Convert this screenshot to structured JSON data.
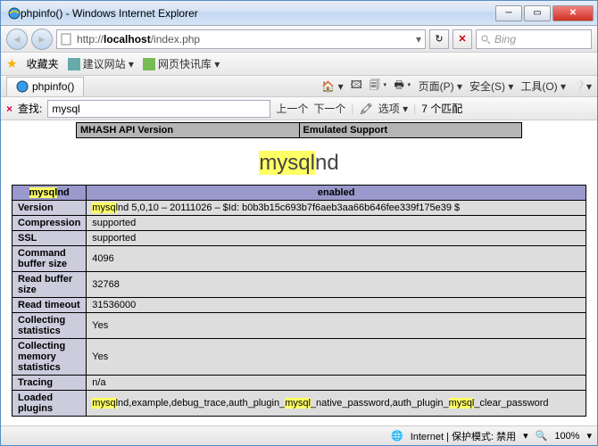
{
  "window": {
    "title": "phpinfo() - Windows Internet Explorer"
  },
  "address": {
    "prefix": "http://",
    "host": "localhost",
    "path": "/index.php"
  },
  "search": {
    "placeholder": "Bing"
  },
  "favbar": {
    "label": "收藏夹",
    "items": [
      "建议网站 ▾",
      "网页快讯库 ▾"
    ]
  },
  "tab": {
    "label": "phpinfo()"
  },
  "toolbar": {
    "items": [
      "🏠 ▾",
      "🖾",
      "🗐 ▾",
      "🖶 ▾",
      "页面(P) ▾",
      "安全(S) ▾",
      "工具(O) ▾",
      "❔▾"
    ]
  },
  "findbar": {
    "label": "查找:",
    "value": "mysql",
    "prev": "上一个",
    "next": "下一个",
    "options": "选项 ▾",
    "matches": "7 个匹配"
  },
  "topbox": {
    "left": "MHASH API Version",
    "right": "Emulated Support"
  },
  "section": {
    "hl": "mysql",
    "rest": "nd"
  },
  "tableHeader": {
    "hl": "mysql",
    "rest": "nd",
    "right": "enabled"
  },
  "rows": [
    {
      "k": "Version",
      "v_pre_hl": "mysql",
      "v": "nd 5,0,10 – 20111026 – $Id: b0b3b15c693b7f6aeb3aa66b646fee339f175e39 $"
    },
    {
      "k": "Compression",
      "v": "supported"
    },
    {
      "k": "SSL",
      "v": "supported"
    },
    {
      "k": "Command buffer size",
      "v": "4096"
    },
    {
      "k": "Read buffer size",
      "v": "32768"
    },
    {
      "k": "Read timeout",
      "v": "31536000"
    },
    {
      "k": "Collecting statistics",
      "v": "Yes"
    },
    {
      "k": "Collecting memory statistics",
      "v": "Yes"
    },
    {
      "k": "Tracing",
      "v": "n/a"
    },
    {
      "k": "Loaded plugins",
      "v_pre_hl": "mysql",
      "v_mid": "nd,example,debug_trace,auth_plugin_",
      "v_hl2": "mysql",
      "v_mid2": "_native_password,auth_plugin_",
      "v_hl3": "mysql",
      "v_end": "_clear_password"
    }
  ],
  "status": {
    "left": "",
    "zone": "Internet | 保护模式: 禁用",
    "zoom": "100%"
  }
}
